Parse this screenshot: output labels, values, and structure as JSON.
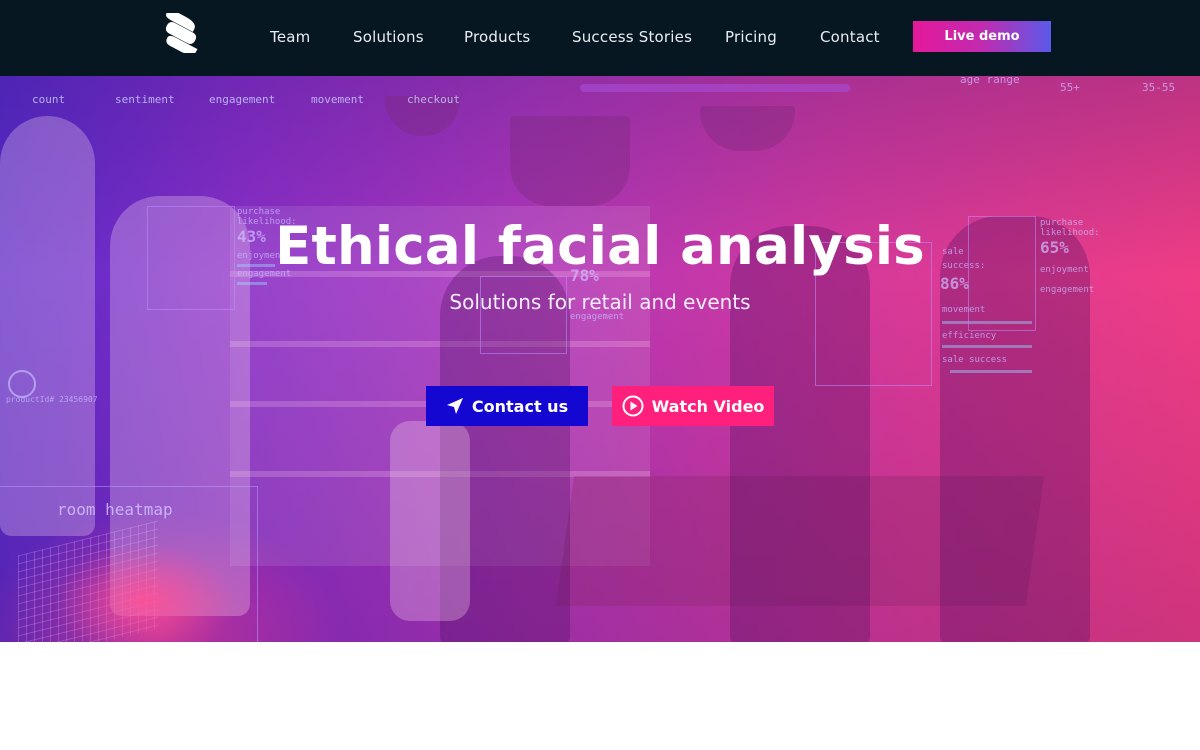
{
  "nav": {
    "links": [
      "Team",
      "Solutions",
      "Products",
      "Success Stories",
      "Pricing",
      "Contact"
    ],
    "demo_button": "Live demo"
  },
  "hero": {
    "title": "Ethical facial analysis",
    "subtitle": "Solutions for retail and events",
    "contact_button": "Contact us",
    "video_button": "Watch Video"
  },
  "overlay": {
    "top_metrics": [
      "count",
      "sentiment",
      "engagement",
      "movement",
      "checkout"
    ],
    "age_range": "age range",
    "age_values": [
      "55+",
      "35-55"
    ],
    "left_box": {
      "line1": "purchase",
      "line2": "likelihood:",
      "value": "43%",
      "enjoyment": "enjoyment",
      "engagement": "engagement"
    },
    "mid_box": {
      "value": "78%",
      "engagement": "engagement"
    },
    "right_box_a": {
      "line1": "sale",
      "line2": "success:",
      "value": "86%",
      "movement": "movement",
      "efficiency": "efficiency",
      "sale_success": "sale success"
    },
    "right_box_b": {
      "line1": "purchase",
      "line2": "likelihood:",
      "value": "65%",
      "enjoyment": "enjoyment",
      "engagement": "engagement"
    },
    "product_id": "productId# 23456907",
    "heatmap_label": "room heatmap"
  },
  "colors": {
    "nav_bg": "#071722",
    "contact_button": "#1507d2",
    "video_button": "#ff1f7c",
    "demo_gradient_start": "#e5189a",
    "demo_gradient_end": "#5b5ae9"
  },
  "icons": {
    "logo": "stacked-stripes-logo",
    "contact": "location-arrow-icon",
    "video": "play-circle-icon"
  }
}
